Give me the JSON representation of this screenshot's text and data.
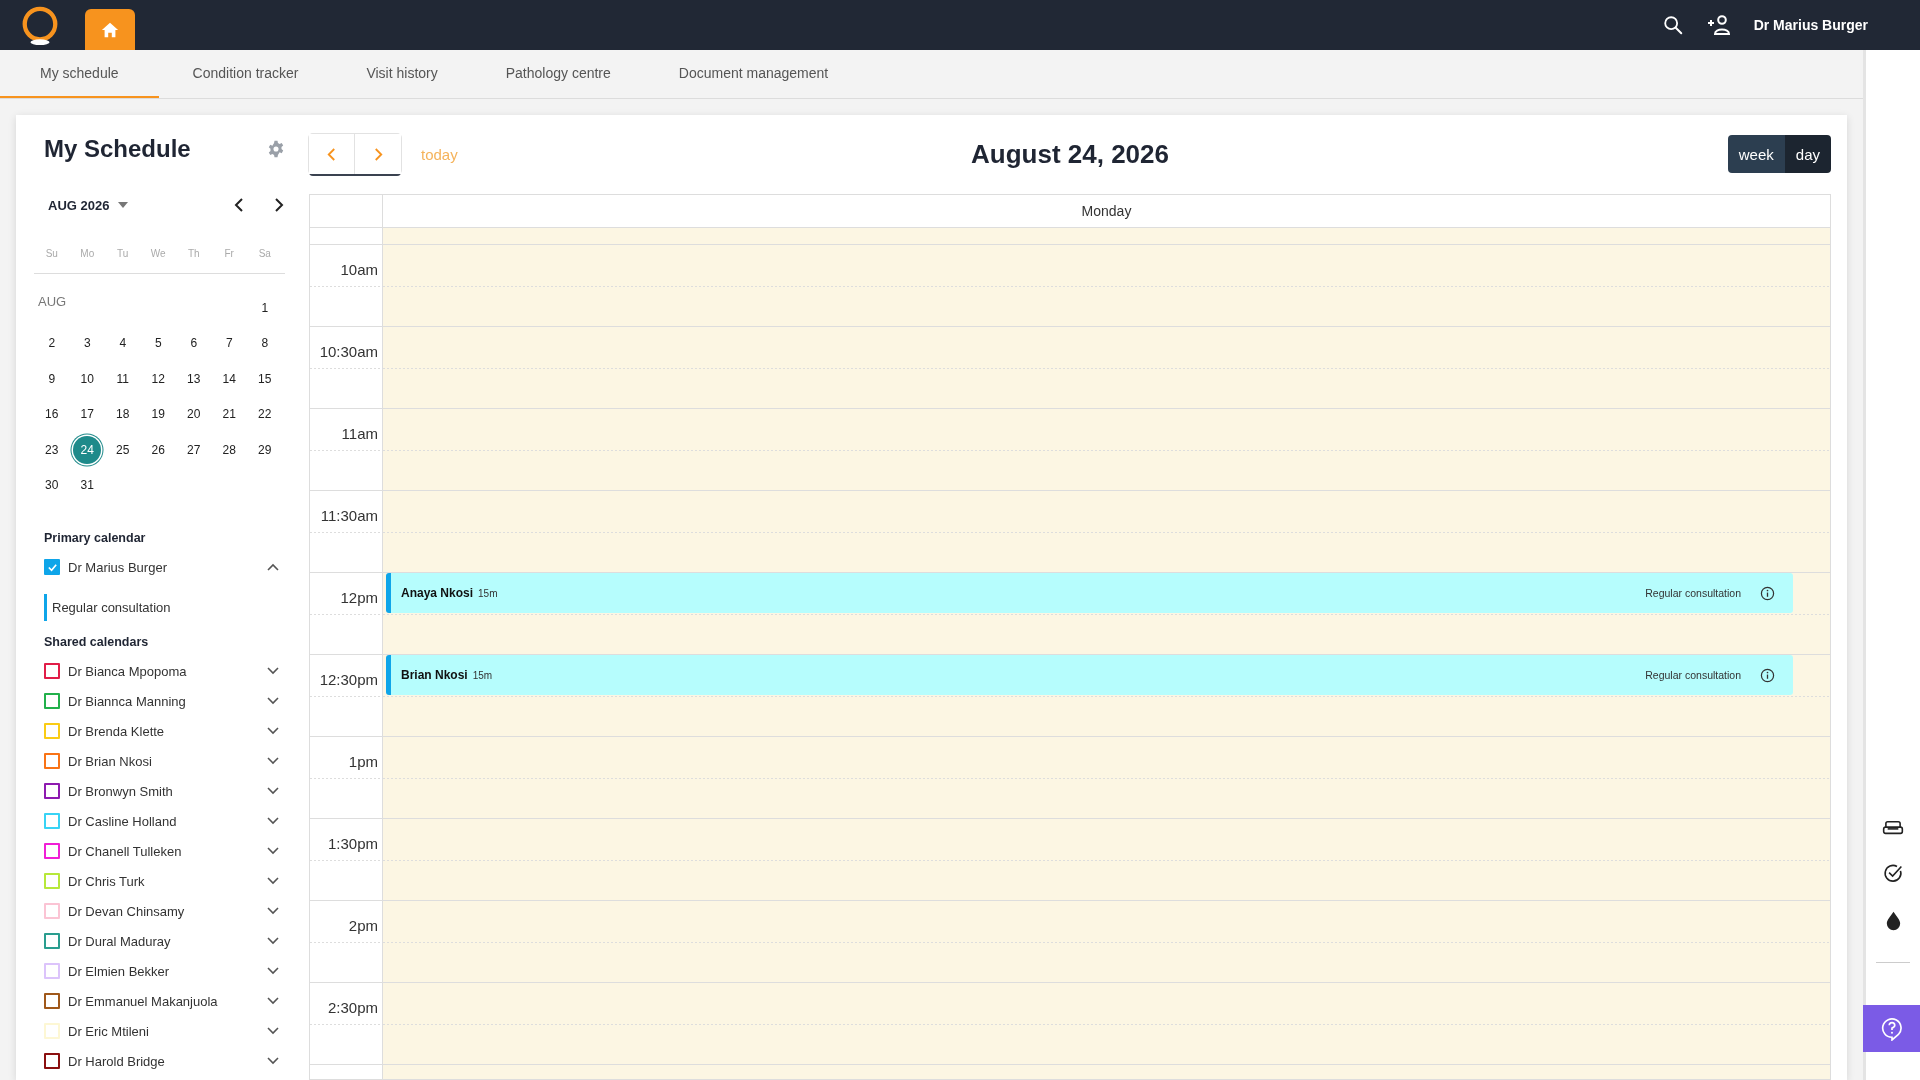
{
  "topbar": {
    "user": "Dr Marius Burger"
  },
  "tabs": [
    {
      "label": "My schedule",
      "selected": true
    },
    {
      "label": "Condition tracker",
      "selected": false
    },
    {
      "label": "Visit history",
      "selected": false
    },
    {
      "label": "Pathology centre",
      "selected": false
    },
    {
      "label": "Document management",
      "selected": false
    }
  ],
  "sidebar": {
    "title": "My Schedule",
    "month_label": "AUG 2026",
    "weekdays": [
      "Su",
      "Mo",
      "Tu",
      "We",
      "Th",
      "Fr",
      "Sa"
    ],
    "month_short": "AUG",
    "weeks": [
      [
        {
          "label": "1",
          "selected": false
        }
      ],
      [
        {
          "label": "2",
          "selected": false
        },
        {
          "label": "3",
          "selected": false
        },
        {
          "label": "4",
          "selected": false
        },
        {
          "label": "5",
          "selected": false
        },
        {
          "label": "6",
          "selected": false
        },
        {
          "label": "7",
          "selected": false
        },
        {
          "label": "8",
          "selected": false
        }
      ],
      [
        {
          "label": "9",
          "selected": false
        },
        {
          "label": "10",
          "selected": false
        },
        {
          "label": "11",
          "selected": false
        },
        {
          "label": "12",
          "selected": false
        },
        {
          "label": "13",
          "selected": false
        },
        {
          "label": "14",
          "selected": false
        },
        {
          "label": "15",
          "selected": false
        }
      ],
      [
        {
          "label": "16",
          "selected": false
        },
        {
          "label": "17",
          "selected": false
        },
        {
          "label": "18",
          "selected": false
        },
        {
          "label": "19",
          "selected": false
        },
        {
          "label": "20",
          "selected": false
        },
        {
          "label": "21",
          "selected": false
        },
        {
          "label": "22",
          "selected": false
        }
      ],
      [
        {
          "label": "23",
          "selected": false
        },
        {
          "label": "24",
          "selected": true
        },
        {
          "label": "25",
          "selected": false
        },
        {
          "label": "26",
          "selected": false
        },
        {
          "label": "27",
          "selected": false
        },
        {
          "label": "28",
          "selected": false
        },
        {
          "label": "29",
          "selected": false
        }
      ],
      [
        {
          "label": "30",
          "selected": false
        },
        {
          "label": "31",
          "selected": false
        }
      ]
    ],
    "primary_calendar": {
      "heading": "Primary calendar",
      "name": "Dr Marius Burger",
      "checked": true,
      "expanded": true,
      "event_types": [
        {
          "label": "Regular consultation",
          "color": "#0ea5e9"
        }
      ]
    },
    "shared_calendars": {
      "heading": "Shared calendars",
      "items": [
        {
          "name": "Dr Bianca Mpopoma",
          "color": "#e11d48",
          "checked": false,
          "expanded": false
        },
        {
          "name": "Dr Biannca Manning",
          "color": "#22b04b",
          "checked": false,
          "expanded": false
        },
        {
          "name": "Dr Brenda Klette",
          "color": "#facc15",
          "checked": false,
          "expanded": false
        },
        {
          "name": "Dr Brian Nkosi",
          "color": "#f97316",
          "checked": false,
          "expanded": false
        },
        {
          "name": "Dr Bronwyn Smith",
          "color": "#8e1ab0",
          "checked": false,
          "expanded": false
        },
        {
          "name": "Dr Casline Holland",
          "color": "#38d3f5",
          "checked": false,
          "expanded": false
        },
        {
          "name": "Dr Chanell Tulleken",
          "color": "#f01fd6",
          "checked": false,
          "expanded": false
        },
        {
          "name": "Dr Chris Turk",
          "color": "#b7e83a",
          "checked": false,
          "expanded": false
        },
        {
          "name": "Dr Devan Chinsamy",
          "color": "#fbc4d4",
          "checked": false,
          "expanded": false
        },
        {
          "name": "Dr Dural Maduray",
          "color": "#2a9d8f",
          "checked": false,
          "expanded": false
        },
        {
          "name": "Dr Elmien Bekker",
          "color": "#dcc4fb",
          "checked": false,
          "expanded": false
        },
        {
          "name": "Dr Emmanuel Makanjuola",
          "color": "#a0581a",
          "checked": false,
          "expanded": false
        },
        {
          "name": "Dr Eric Mtileni",
          "color": "#fdf7d4",
          "checked": false,
          "expanded": false
        },
        {
          "name": "Dr Harold Bridge",
          "color": "#8b0f0f",
          "checked": false,
          "expanded": false
        }
      ]
    }
  },
  "toolbar": {
    "today": "today",
    "date": "August 24, 2026",
    "views": [
      {
        "label": "week",
        "selected": false
      },
      {
        "label": "day",
        "selected": true
      }
    ]
  },
  "day_view": {
    "column": "Monday",
    "slots": [
      {
        "time": "10am"
      },
      {
        "time": "10:30am"
      },
      {
        "time": "11am"
      },
      {
        "time": "11:30am"
      },
      {
        "time": "12pm",
        "events": [
          {
            "patient": "Anaya Nkosi",
            "duration": "15m",
            "type": "Regular consultation"
          }
        ]
      },
      {
        "time": "12:30pm",
        "events": [
          {
            "patient": "Brian Nkosi",
            "duration": "15m",
            "type": "Regular consultation"
          }
        ]
      },
      {
        "time": "1pm"
      },
      {
        "time": "1:30pm"
      },
      {
        "time": "2pm"
      },
      {
        "time": "2:30pm"
      }
    ]
  }
}
